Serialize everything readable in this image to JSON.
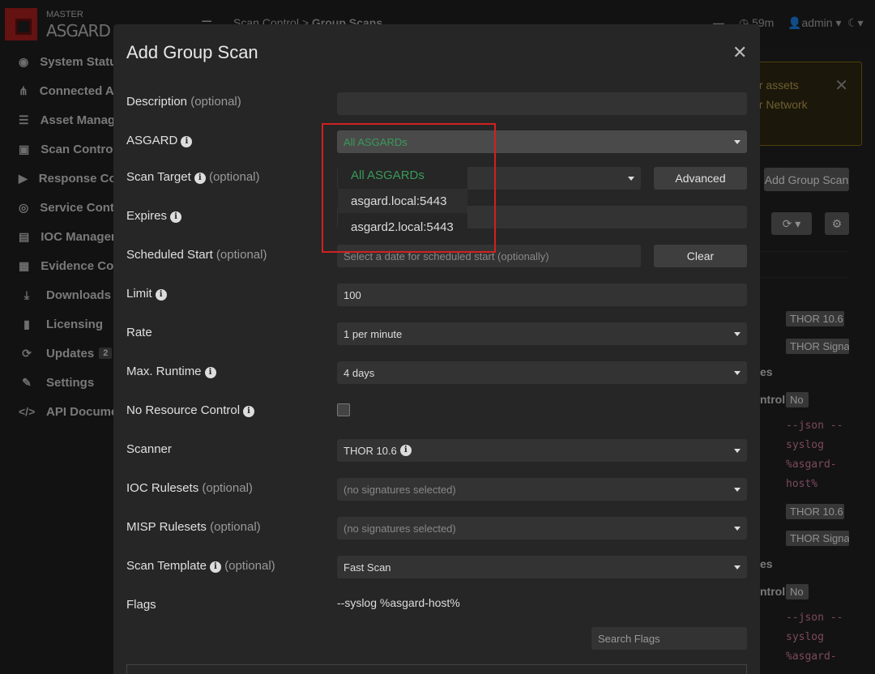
{
  "header": {
    "logo_top": "MASTER",
    "logo_bottom": "ASGARD",
    "breadcrumb": [
      "Scan Control",
      ">",
      "Group Scans"
    ],
    "session_time": "59m",
    "user": "admin"
  },
  "sidebar": {
    "items": [
      {
        "label": "System Status",
        "icon": "dashboard-icon"
      },
      {
        "label": "Connected Asgards",
        "icon": "network-icon"
      },
      {
        "label": "Asset Management",
        "icon": "server-icon"
      },
      {
        "label": "Scan Control",
        "icon": "scan-icon"
      },
      {
        "label": "Response Control",
        "icon": "play-icon"
      },
      {
        "label": "Service Control",
        "icon": "target-icon"
      },
      {
        "label": "IOC Management",
        "icon": "chart-icon"
      },
      {
        "label": "Evidence Collection",
        "icon": "evidence-icon"
      },
      {
        "label": "Downloads",
        "icon": "download-icon"
      },
      {
        "label": "Licensing",
        "icon": "license-icon"
      },
      {
        "label": "Updates",
        "icon": "refresh-icon",
        "badge": "2"
      },
      {
        "label": "Settings",
        "icon": "wrench-icon"
      },
      {
        "label": "API Documentation",
        "icon": "code-icon"
      }
    ]
  },
  "background": {
    "alert_line1": "or assets",
    "alert_line2": "er Network",
    "add_group_scan": "Add Group Scan",
    "tag_thor_a": "THOR 10.6",
    "tag_sig_a": "THOR Signatures",
    "text_es_a": "es",
    "text_ntrol_a": "ntrol",
    "tag_no_a": "No",
    "code_a": [
      "--json --",
      "syslog",
      "%asgard-",
      "host%"
    ],
    "tag_thor_b": "THOR 10.6",
    "tag_sig_b": "THOR Signatures",
    "text_es_b": "es",
    "text_ntrol_b": "ntrol",
    "tag_no_b": "No",
    "code_b": [
      "--json --",
      "syslog",
      "%asgard-"
    ]
  },
  "modal": {
    "title": "Add Group Scan",
    "optional": "(optional)",
    "fields": {
      "description": {
        "label": "Description",
        "value": ""
      },
      "asgard": {
        "label": "ASGARD",
        "value": "All ASGARDs"
      },
      "scan_target": {
        "label": "Scan Target",
        "value": "",
        "button": "Advanced"
      },
      "expires": {
        "label": "Expires",
        "value": ""
      },
      "scheduled_start": {
        "label": "Scheduled Start",
        "placeholder": "Select a date for scheduled start (optionally)",
        "button": "Clear"
      },
      "limit": {
        "label": "Limit",
        "value": "100"
      },
      "rate": {
        "label": "Rate",
        "value": "1 per minute"
      },
      "max_runtime": {
        "label": "Max. Runtime",
        "value": "4 days"
      },
      "no_resource_control": {
        "label": "No Resource Control",
        "checked": false
      },
      "scanner": {
        "label": "Scanner",
        "value": "THOR 10.6"
      },
      "ioc_rulesets": {
        "label": "IOC Rulesets",
        "placeholder": "(no signatures selected)"
      },
      "misp_rulesets": {
        "label": "MISP Rulesets",
        "placeholder": "(no signatures selected)"
      },
      "scan_template": {
        "label": "Scan Template",
        "value": "Fast Scan"
      },
      "flags": {
        "label": "Flags",
        "value": "--syslog %asgard-host%",
        "search_placeholder": "Search Flags"
      }
    }
  },
  "asgard_dropdown": {
    "options": [
      "All ASGARDs",
      "asgard.local:5443",
      "asgard2.local:5443"
    ],
    "selected": "All ASGARDs"
  },
  "colors": {
    "accent_green": "#3a9a5a",
    "highlight_red": "#d02020",
    "brand_red": "#9b1c1c"
  }
}
